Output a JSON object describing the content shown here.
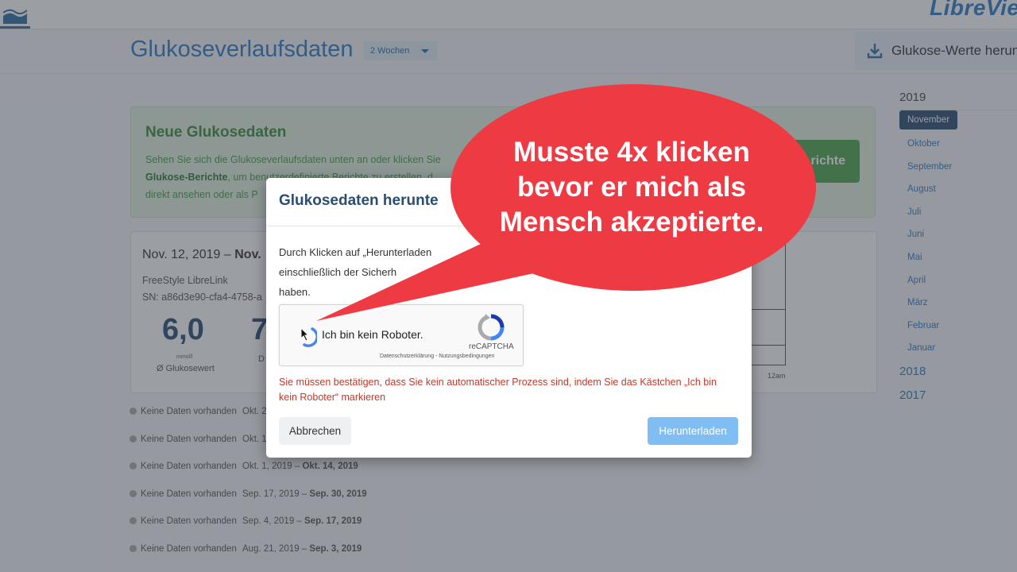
{
  "header": {
    "brand": "LibreVie",
    "page_title": "Glukoseverlaufsdaten",
    "range_dropdown": "2 Wochen",
    "download_button": "Glukose-Werte herun"
  },
  "banner": {
    "title": "Neue Glukosedaten",
    "text_before": "Sehen Sie sich die Glukoseverlaufsdaten unten an oder klicken Sie",
    "link_text": "Glukose-Berichte",
    "text_after": ", um benutzerdefinierte Berichte zu erstellen, d",
    "text_line3": "direkt ansehen oder als P",
    "button": "richte"
  },
  "summary": {
    "period_start": "Nov. 12, 2019 –",
    "period_end": "Nov.",
    "device": "FreeStyle LibreLink",
    "serial": "SN: a86d3e90-cfa4-4758-a",
    "avg_value": "6,0",
    "avg_unit": "mmol/l",
    "avg_label": "Ø Glukosewert",
    "second_value": "7",
    "second_label": "D",
    "chart_tick": "12am"
  },
  "history": [
    {
      "status": "Keine Daten vorhanden",
      "start": "Okt. 2",
      "end": ""
    },
    {
      "status": "Keine Daten vorhanden",
      "start": "Okt. 1",
      "end": ""
    },
    {
      "status": "Keine Daten vorhanden",
      "start": "Okt. 1, 2019 –",
      "end": "Okt. 14, 2019"
    },
    {
      "status": "Keine Daten vorhanden",
      "start": "Sep. 17, 2019 –",
      "end": "Sep. 30, 2019"
    },
    {
      "status": "Keine Daten vorhanden",
      "start": "Sep. 4, 2019 –",
      "end": "Sep. 17, 2019"
    },
    {
      "status": "Keine Daten vorhanden",
      "start": "Aug. 21, 2019 –",
      "end": "Sep. 3, 2019"
    }
  ],
  "sidebar": {
    "year": "2019",
    "months": [
      "November",
      "Oktober",
      "September",
      "August",
      "Juli",
      "Juni",
      "Mai",
      "April",
      "März",
      "Februar",
      "Januar"
    ],
    "other_years": [
      "2018",
      "2017"
    ]
  },
  "modal": {
    "title": "Glukosedaten herunte",
    "body_line1": "Durch Klicken auf „Herunterladen",
    "body_line2": "einschließlich der Sicherh",
    "body_line3": "haben.",
    "captcha_label": "Ich bin kein Roboter.",
    "captcha_brand": "reCAPTCHA",
    "captcha_terms": "Datenschutzerklärung - Nutzungsbedingungen",
    "error": "Sie müssen bestätigen, dass Sie kein automatischer Prozess sind, indem Sie das Kästchen „Ich bin kein Roboter“ markieren",
    "cancel": "Abbrechen",
    "download": "Herunterladen"
  },
  "annotation": {
    "line1": "Musste 4x klicken",
    "line2": "bevor er mich als",
    "line3": "Mensch akzeptierte."
  },
  "colors": {
    "brand_blue": "#2e7bc4",
    "banner_green": "#4da54d",
    "error_red": "#c0392b",
    "bubble_red": "#ee3a43"
  },
  "icons": [
    "librelink-home-icon",
    "download-icon",
    "caret-down-icon",
    "recaptcha-logo-icon",
    "cursor-icon",
    "loading-spinner-icon"
  ]
}
